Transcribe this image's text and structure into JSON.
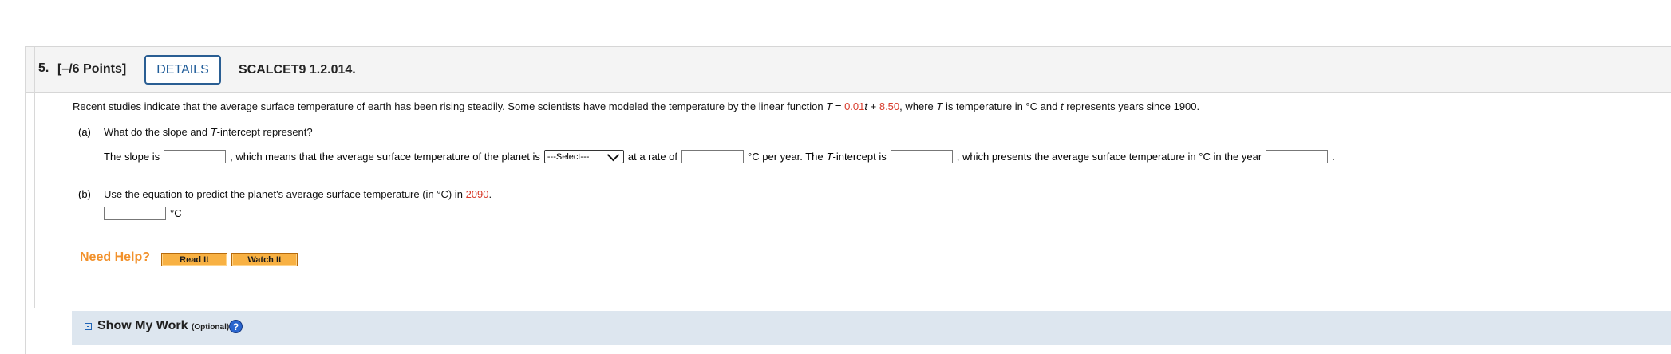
{
  "question": {
    "number": "5.",
    "points": "[–/6 Points]",
    "details_button": "DETAILS",
    "code": "SCALCET9 1.2.014.",
    "intro_prefix": "Recent studies indicate that the average surface temperature of earth has been rising steadily. Some scientists have modeled the temperature by the linear function",
    "intro_equation_left": "T",
    "intro_equals": "=",
    "intro_slope": "0.01",
    "intro_variable": "t",
    "intro_plus": "+",
    "intro_intercept": "8.50",
    "intro_suffix_1": ", where",
    "intro_suffix_T": "T",
    "intro_suffix_2": "is temperature in °C and",
    "intro_suffix_t": "t",
    "intro_suffix_3": "represents years since 1900."
  },
  "part_a": {
    "label": "(a)",
    "prompt_prefix": "What do the slope and",
    "prompt_T": "T",
    "prompt_suffix": "-intercept represent?",
    "line_prefix": "The slope is",
    "line_middle_1": ", which means that the average surface temperature of the planet is",
    "select_value": "---Select---",
    "line_middle_2": "at a rate of",
    "line_middle_3": "°C per year. The",
    "line_T": "T",
    "line_middle_4": "-intercept is",
    "line_middle_5": ", which presents the average surface temperature in °C in the year",
    "line_suffix": "."
  },
  "part_b": {
    "label": "(b)",
    "prompt_prefix": "Use the equation to predict the planet's average surface temperature (in °C) in",
    "year": "2090",
    "prompt_suffix": ".",
    "unit": "°C"
  },
  "help": {
    "label": "Need Help?",
    "read_button": "Read It",
    "watch_button": "Watch It"
  },
  "work": {
    "title": "Show My Work",
    "optional": "(Optional)",
    "help_icon": "?"
  },
  "colors": {
    "red": "#d83a2a",
    "details_blue": "#1f5c99",
    "help_orange": "#f2912b",
    "button_orange": "#f8b143",
    "work_panel": "#dde6ef"
  }
}
